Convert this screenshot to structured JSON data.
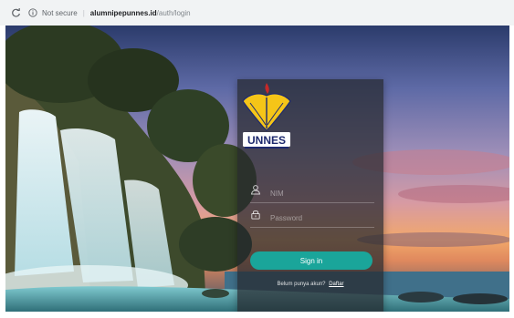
{
  "browser": {
    "security_label": "Not secure",
    "url_separator": "|",
    "url_host": "alumnipepunnes.id",
    "url_path": "/auth/login"
  },
  "logo": {
    "text": "UNNES",
    "colors": {
      "gold": "#f5c518",
      "navy": "#1e2a6e",
      "red": "#c62828"
    }
  },
  "login": {
    "username_placeholder": "NIM",
    "password_placeholder": "Password",
    "signin_label": "Sign in",
    "register_prompt": "Belum punya akun?",
    "register_link": "Daftar"
  },
  "colors": {
    "accent": "#1aa59a",
    "panel": "#26282e"
  }
}
